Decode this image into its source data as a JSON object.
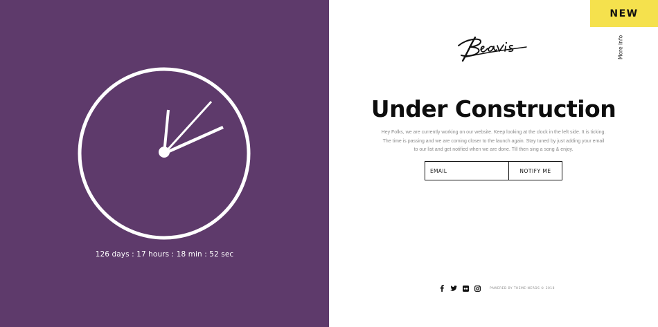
{
  "clock": {
    "countdown": "126 days : 17 hours : 18 min : 52 sec"
  },
  "badge": {
    "label": "NEW"
  },
  "side_link": {
    "label": "More Info"
  },
  "logo": {
    "text": "Beavis"
  },
  "main": {
    "title": "Under Construction",
    "description": "Hey Folks, we are currently working on our website. Keep looking at the clock in the left side. It is ticking. The time is passing and we are coming closer to the launch again. Stay tuned by just adding your email to our list and get notified when we are done. Till then sing a song & enjoy."
  },
  "form": {
    "email_placeholder": "EMAIL",
    "submit_label": "NOTIFY ME"
  },
  "footer": {
    "social_icons": [
      "facebook-icon",
      "twitter-icon",
      "flickr-icon",
      "instagram-icon"
    ],
    "credits": "Pawered by Theme-Nerds © 2018"
  },
  "colors": {
    "left_panel": "#5e3a6b",
    "badge": "#f5e14d",
    "clock_stroke": "#ffffff"
  }
}
